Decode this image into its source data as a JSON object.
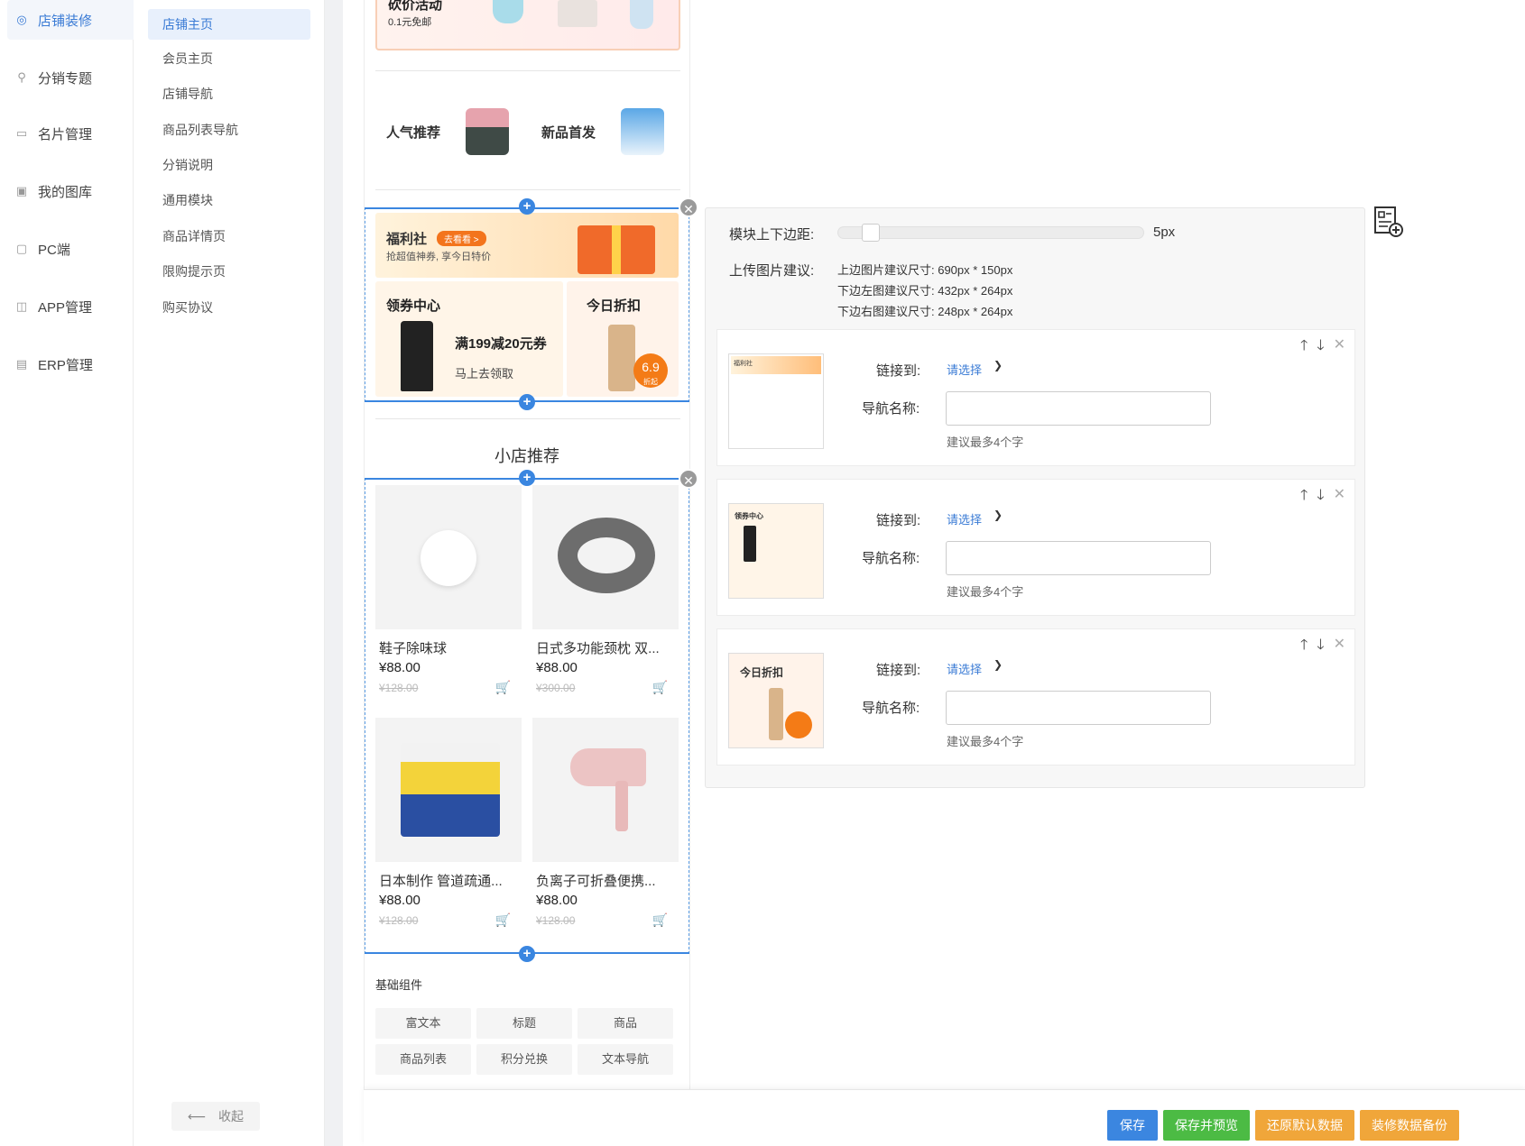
{
  "main_nav": [
    {
      "label": "店铺装修",
      "icon": "palette-icon",
      "active": true
    },
    {
      "label": "分销专题",
      "icon": "share-users-icon"
    },
    {
      "label": "名片管理",
      "icon": "card-icon"
    },
    {
      "label": "我的图库",
      "icon": "image-icon"
    },
    {
      "label": "PC端",
      "icon": "monitor-icon"
    },
    {
      "label": "APP管理",
      "icon": "app-icon"
    },
    {
      "label": "ERP管理",
      "icon": "erp-icon"
    }
  ],
  "sub_nav": [
    {
      "label": "店铺主页",
      "active": true
    },
    {
      "label": "会员主页"
    },
    {
      "label": "店铺导航"
    },
    {
      "label": "商品列表导航"
    },
    {
      "label": "分销说明"
    },
    {
      "label": "通用模块"
    },
    {
      "label": "商品详情页"
    },
    {
      "label": "限购提示页"
    },
    {
      "label": "购买协议"
    }
  ],
  "collapse_label": "收起",
  "preview": {
    "top_banner": {
      "title": "砍价活动",
      "subtitle": "0.1元免邮"
    },
    "promo_cards": [
      {
        "label": "人气推荐",
        "bg": "#f6ede4"
      },
      {
        "label": "新品首发",
        "bg": "#e3eef8"
      }
    ],
    "fuli": {
      "title": "福利社",
      "pill": "去看看 >",
      "subtitle": "抢超值神券, 享今日特价"
    },
    "coupon": {
      "title": "领券中心",
      "big": "满199减20元券",
      "small": "马上去领取"
    },
    "discount": {
      "title": "今日折扣",
      "badge_value": "6.9",
      "badge_unit": "折起"
    },
    "section_title": "小店推荐",
    "products": [
      {
        "name": "鞋子除味球",
        "price": "¥88.00",
        "orig": "¥128.00"
      },
      {
        "name": "日式多功能颈枕 双...",
        "price": "¥88.00",
        "orig": "¥300.00"
      },
      {
        "name": "日本制作 管道疏通...",
        "price": "¥88.00",
        "orig": "¥128.00"
      },
      {
        "name": "负离子可折叠便携...",
        "price": "¥88.00",
        "orig": "¥128.00"
      }
    ],
    "components_title": "基础组件",
    "components": [
      "富文本",
      "标题",
      "商品",
      "商品列表",
      "积分兑换",
      "文本导航"
    ]
  },
  "config": {
    "margin_label": "模块上下边距:",
    "margin_value": "5px",
    "upload_label": "上传图片建议:",
    "upload_hints": [
      "上边图片建议尺寸: 690px * 150px",
      "下边左图建议尺寸: 432px * 264px",
      "下边右图建议尺寸: 248px * 264px"
    ],
    "items": [
      {
        "link_label": "链接到:",
        "link_value": "请选择",
        "name_label": "导航名称:",
        "name_value": "",
        "tip": "建议最多4个字",
        "thumb": "福利社"
      },
      {
        "link_label": "链接到:",
        "link_value": "请选择",
        "name_label": "导航名称:",
        "name_value": "",
        "tip": "建议最多4个字",
        "thumb": "领券中心"
      },
      {
        "link_label": "链接到:",
        "link_value": "请选择",
        "name_label": "导航名称:",
        "name_value": "",
        "tip": "建议最多4个字",
        "thumb": "今日折扣"
      }
    ]
  },
  "bottom_bar": {
    "save": "保存",
    "save_preview": "保存并预览",
    "restore": "还原默认数据",
    "backup": "装修数据备份"
  },
  "colors": {
    "primary": "#3a7bd5",
    "save": "#3b86e0",
    "save_preview": "#4cbb44",
    "restore": "#f0a63a",
    "backup": "#f0a63a"
  }
}
